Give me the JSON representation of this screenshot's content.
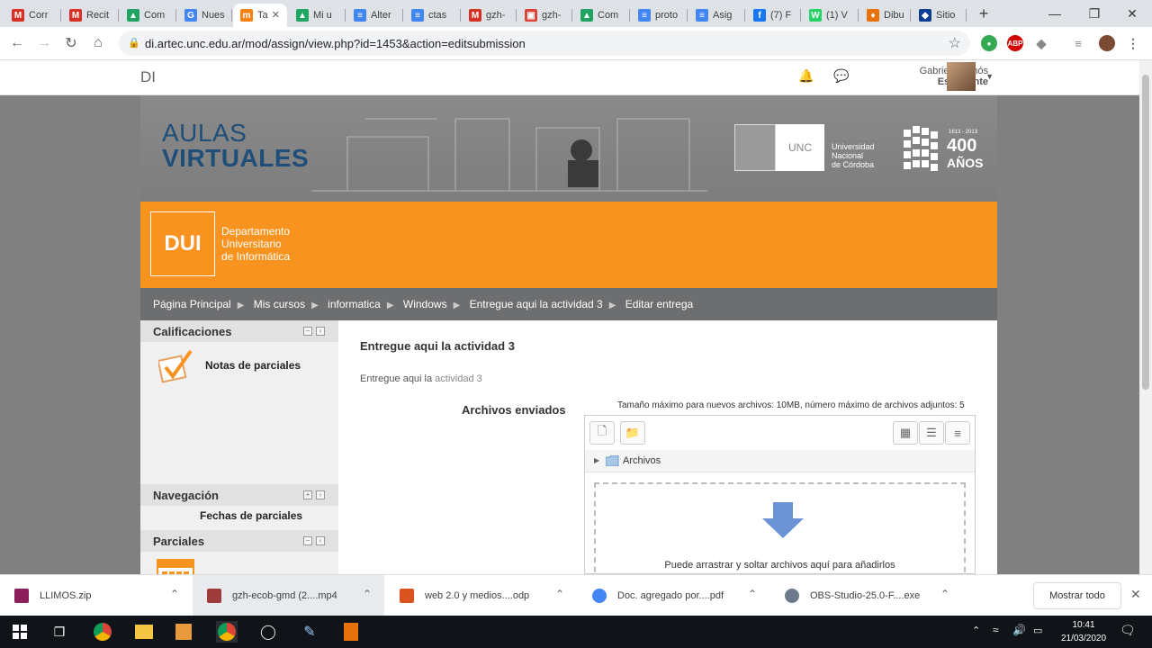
{
  "browser": {
    "tabs": [
      {
        "label": "Corr",
        "icon": "gmail-icon",
        "color": "#d93025"
      },
      {
        "label": "Recit",
        "icon": "gmail-icon",
        "color": "#d93025"
      },
      {
        "label": "Com",
        "icon": "drive-icon",
        "color": "#1fa463"
      },
      {
        "label": "Nues",
        "icon": "google-icon",
        "color": "#4285f4"
      },
      {
        "label": "Ta",
        "icon": "moodle-icon",
        "color": "#f98012",
        "active": true
      },
      {
        "label": "Mi u",
        "icon": "drive-icon",
        "color": "#1fa463"
      },
      {
        "label": "Alter",
        "icon": "docs-icon",
        "color": "#4285f4"
      },
      {
        "label": "ctas",
        "icon": "docs-icon",
        "color": "#4285f4"
      },
      {
        "label": "gzh-",
        "icon": "gmail-icon",
        "color": "#d93025"
      },
      {
        "label": "gzh-",
        "icon": "calendar-icon",
        "color": "#db4437"
      },
      {
        "label": "Com",
        "icon": "drive-icon",
        "color": "#1fa463"
      },
      {
        "label": "proto",
        "icon": "docs-icon",
        "color": "#4285f4"
      },
      {
        "label": "Asig",
        "icon": "docs-icon",
        "color": "#4285f4"
      },
      {
        "label": "(7) F",
        "icon": "facebook-icon",
        "color": "#1877f2"
      },
      {
        "label": "(1) V",
        "icon": "whatsapp-icon",
        "color": "#25d366"
      },
      {
        "label": "Dibu",
        "icon": "paint-icon",
        "color": "#e8710a"
      },
      {
        "label": "Sitio",
        "icon": "site-icon",
        "color": "#0b3d91"
      }
    ],
    "url": "di.artec.unc.edu.ar/mod/assign/view.php?id=1453&action=editsubmission"
  },
  "site": {
    "brand": "DI",
    "user_name": "Gabriela Llimós",
    "user_role": "Estudiante",
    "aulas_line1": "AULAS",
    "aulas_line2": "VIRTUALES",
    "unc_label": "UNC",
    "unc_text": [
      "Universidad",
      "Nacional",
      "de Córdoba"
    ],
    "anos_range": "1613 - 2013",
    "anos_number": "400",
    "anos_word": "AÑOS",
    "dui_logo": "DUI",
    "dept_lines": [
      "Departamento",
      "Universitario",
      "de Informática"
    ]
  },
  "breadcrumb": [
    "Página Principal",
    "Mis cursos",
    "informatica",
    "Windows",
    "Entregue aqui la actividad 3",
    "Editar entrega"
  ],
  "sidebar": {
    "calificaciones": {
      "title": "Calificaciones",
      "item": "Notas de parciales"
    },
    "navegacion": {
      "title": "Navegación"
    },
    "parciales": {
      "title": "Parciales",
      "item": "Fechas de parciales"
    }
  },
  "main": {
    "title": "Entregue aqui la actividad 3",
    "desc_prefix": "Entregue aqui la ",
    "desc_link": "actividad 3",
    "archivos_label": "Archivos enviados",
    "limits": "Tamaño máximo para nuevos archivos: 10MB, número máximo de archivos adjuntos: 5",
    "folder": "Archivos",
    "drop_text": "Puede arrastrar y soltar archivos aquí para añadirlos"
  },
  "downloads": [
    {
      "name": "LLIMOS.zip",
      "icon": "winrar-icon",
      "color": "#8b1f5c"
    },
    {
      "name": "gzh-ecob-gmd (2....mp4",
      "icon": "video-file-icon",
      "color": "#9e3b3b"
    },
    {
      "name": "web 2.0 y medios....odp",
      "icon": "presentation-file-icon",
      "color": "#d9531e"
    },
    {
      "name": "Doc. agregado por....pdf",
      "icon": "chrome-icon",
      "color": "#4285f4"
    },
    {
      "name": "OBS-Studio-25.0-F....exe",
      "icon": "installer-icon",
      "color": "#6c7a89"
    }
  ],
  "shelf": {
    "show_all": "Mostrar todo"
  },
  "taskbar": {
    "time": "10:41",
    "date": "21/03/2020"
  }
}
